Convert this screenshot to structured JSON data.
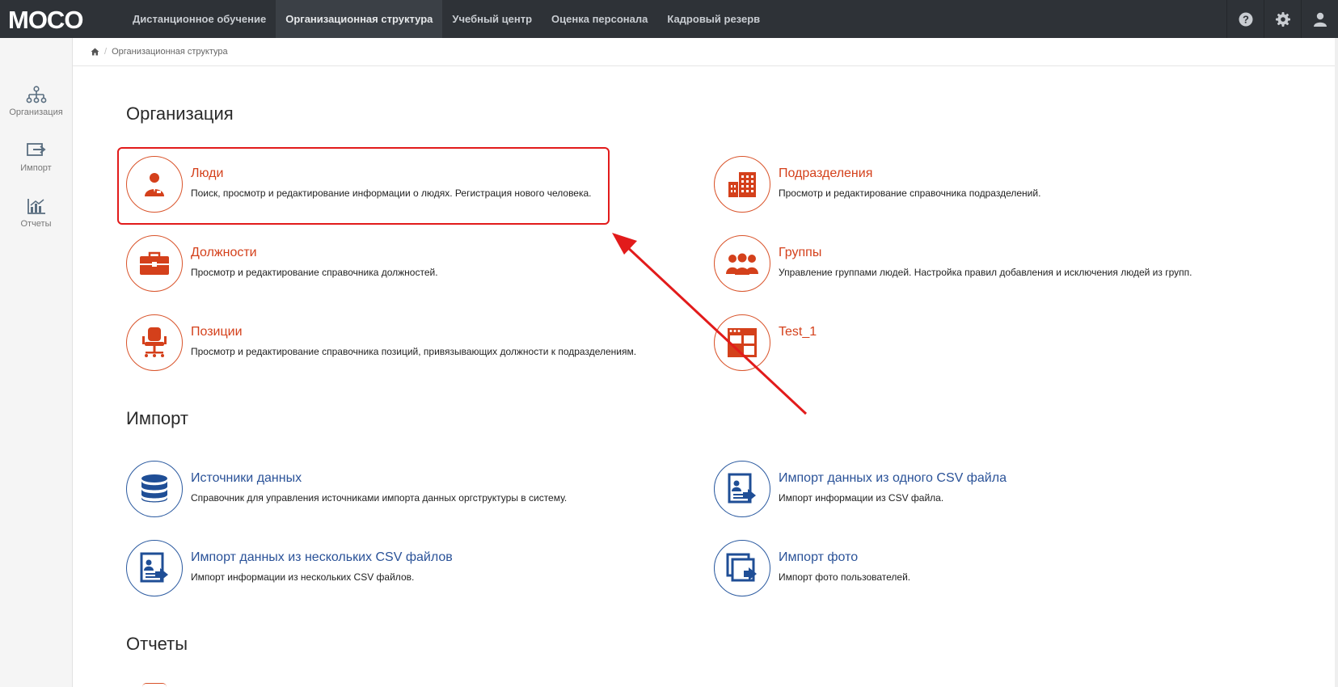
{
  "app": {
    "logo_text": "MOCO"
  },
  "nav": {
    "items": [
      {
        "label": "Дистанционное обучение",
        "active": false
      },
      {
        "label": "Организационная структура",
        "active": true
      },
      {
        "label": "Учебный центр",
        "active": false
      },
      {
        "label": "Оценка персонала",
        "active": false
      },
      {
        "label": "Кадровый резерв",
        "active": false
      }
    ]
  },
  "top_right": {
    "icons": [
      "question-icon",
      "gear-icon",
      "user-icon"
    ]
  },
  "sidebar": {
    "items": [
      {
        "label": "Организация",
        "icon": "org-tree-icon"
      },
      {
        "label": "Импорт",
        "icon": "import-icon"
      },
      {
        "label": "Отчеты",
        "icon": "chart-icon"
      }
    ]
  },
  "breadcrumb": {
    "home_icon": "home-icon",
    "current": "Организационная структура"
  },
  "sections": {
    "organization": {
      "title": "Организация",
      "cards": [
        {
          "title": "Люди",
          "desc": "Поиск, просмотр и редактирование информации о людях. Регистрация нового человека.",
          "icon": "person-icon"
        },
        {
          "title": "Подразделения",
          "desc": "Просмотр и редактирование справочника подразделений.",
          "icon": "buildings-icon"
        },
        {
          "title": "Должности",
          "desc": "Просмотр и редактирование справочника должностей.",
          "icon": "briefcase-icon"
        },
        {
          "title": "Группы",
          "desc": "Управление группами людей. Настройка правил добавления и исключения людей из групп.",
          "icon": "group-icon"
        },
        {
          "title": "Позиции",
          "desc": "Просмотр и редактирование справочника позиций, привязывающих должности к подразделениям.",
          "icon": "office-chair-icon"
        },
        {
          "title": "Test_1",
          "desc": "",
          "icon": "window-layout-icon"
        }
      ]
    },
    "import": {
      "title": "Импорт",
      "cards": [
        {
          "title": "Источники данных",
          "desc": "Справочник для управления источниками импорта данных оргструктуры в систему.",
          "icon": "database-icon"
        },
        {
          "title": "Импорт данных из одного CSV файла",
          "desc": "Импорт информации из CSV файла.",
          "icon": "csv-import-icon"
        },
        {
          "title": "Импорт данных из нескольких CSV файлов",
          "desc": "Импорт информации из нескольких CSV файлов.",
          "icon": "csv-multi-import-icon"
        },
        {
          "title": "Импорт фото",
          "desc": "Импорт фото пользователей.",
          "icon": "photo-import-icon"
        }
      ]
    },
    "reports": {
      "title": "Отчеты"
    }
  },
  "colors": {
    "topbar": "#2e3237",
    "orange": "#d4401b",
    "blue": "#2a5298",
    "annotation_red": "#e21b1b"
  }
}
